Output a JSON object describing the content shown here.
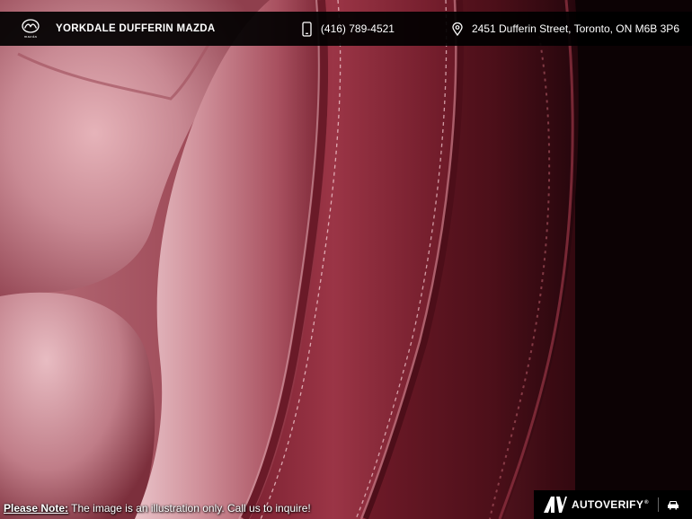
{
  "header": {
    "dealer_name": "YORKDALE DUFFERIN MAZDA",
    "logo_wordmark": "mazda",
    "phone": "(416) 789-4521",
    "address": "2451 Dufferin Street, Toronto, ON M6B 3P6"
  },
  "photo": {
    "subject": "red-leather-seat-closeup"
  },
  "footer": {
    "note_label": "Please Note:",
    "note_text": " The image is an illustration only. Call us to inquire!"
  },
  "badge": {
    "brand": "AUTOVERIFY",
    "reg_mark": "®"
  },
  "colors": {
    "leather_light": "#c97e89",
    "leather_mid": "#9e3b4b",
    "leather_dark": "#5a1521",
    "background_dark": "#120306",
    "bar": "#000000",
    "text": "#ffffff"
  },
  "icons": {
    "brand_logo": "mazda-logo-icon",
    "phone": "phone-icon",
    "address": "map-pin-icon",
    "badge_logo": "autoverify-logo-icon",
    "badge_car": "car-icon"
  }
}
